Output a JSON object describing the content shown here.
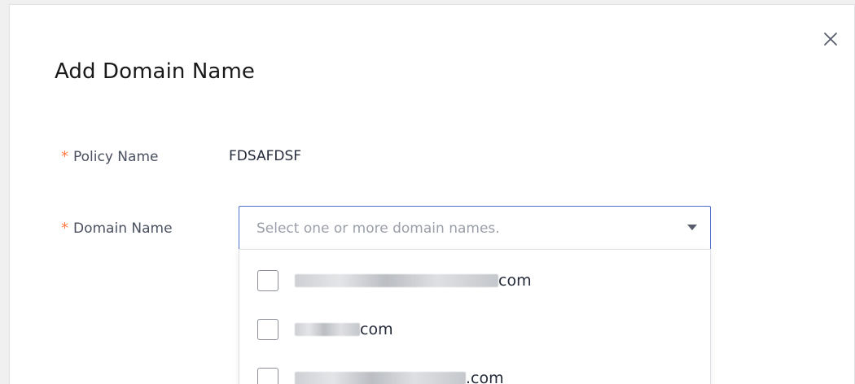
{
  "dialog": {
    "title": "Add Domain Name",
    "close_icon": "close-icon"
  },
  "form": {
    "policy": {
      "required_mark": "*",
      "label": "Policy Name",
      "value": "FDSAFDSF"
    },
    "domain": {
      "required_mark": "*",
      "label": "Domain Name",
      "placeholder": "Select one or more domain names.",
      "caret_icon": "caret-down-icon",
      "options": [
        {
          "suffix": "com",
          "checked": false
        },
        {
          "suffix": "com",
          "checked": false
        },
        {
          "suffix": ".com",
          "checked": false
        }
      ]
    }
  },
  "colors": {
    "required": "#ff7a45",
    "select_border": "#526ecc",
    "placeholder": "#9a9ea8"
  }
}
